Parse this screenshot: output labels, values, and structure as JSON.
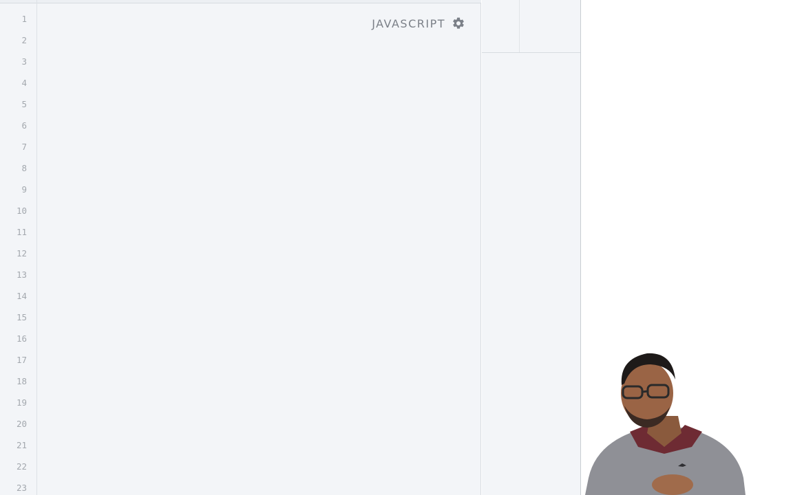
{
  "editor": {
    "language_label": "JAVASCRIPT",
    "settings_icon": "gear-icon",
    "line_numbers": [
      "1",
      "2",
      "3",
      "4",
      "5",
      "6",
      "7",
      "8",
      "9",
      "10",
      "11",
      "12",
      "13",
      "14",
      "15",
      "16",
      "17",
      "18",
      "19",
      "20",
      "21",
      "22",
      "23"
    ]
  },
  "colors": {
    "editor_background": "#f3f5f8",
    "line_number": "#a3a8ae",
    "language_label": "#7b8088",
    "page_background": "#ffffff"
  }
}
